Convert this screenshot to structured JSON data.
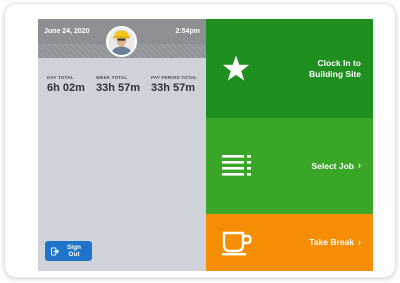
{
  "header": {
    "date": "June 24, 2020",
    "time": "2:54pm"
  },
  "stats": [
    {
      "label": "DAY TOTAL",
      "value": "6h 02m"
    },
    {
      "label": "WEEK TOTAL",
      "value": "33h 57m"
    },
    {
      "label": "PAY PERIOD TOTAL",
      "value": "33h 57m"
    }
  ],
  "signout": {
    "label": "Sign Out"
  },
  "tiles": {
    "clock_in": {
      "line1": "Clock In to",
      "line2": "Building Site",
      "icon": "star-icon"
    },
    "select_job": {
      "label": "Select Job",
      "icon": "list-icon"
    },
    "take_break": {
      "label": "Take Break",
      "icon": "coffee-cup-icon"
    }
  },
  "colors": {
    "header": "#8d8f93",
    "panel": "#cfd3d9",
    "clock_tile": "#1f8f1f",
    "job_tile": "#3aa628",
    "break_tile": "#f58d05",
    "signout_button": "#1f73c8"
  }
}
